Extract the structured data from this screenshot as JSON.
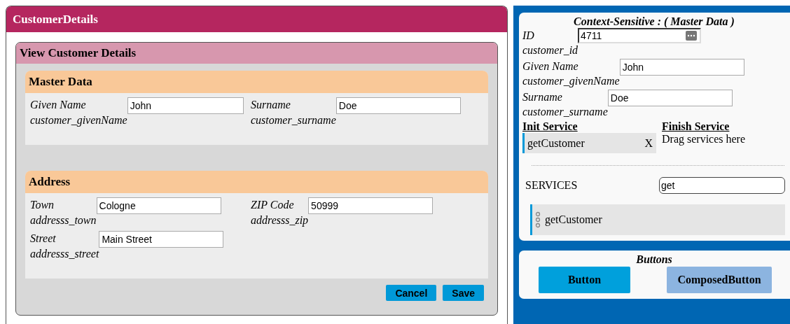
{
  "window": {
    "title": "CustomerDetails"
  },
  "view": {
    "title": "View Customer Details",
    "sections": [
      {
        "title": "Master Data",
        "fields": [
          {
            "label": "Given Name",
            "binding": "customer_givenName",
            "value": "John"
          },
          {
            "label": "Surname",
            "binding": "customer_surname",
            "value": "Doe"
          }
        ]
      },
      {
        "title": "Address",
        "fields": [
          {
            "label": "Town",
            "binding": "addresss_town",
            "value": "Cologne"
          },
          {
            "label": "ZIP Code",
            "binding": "addresss_zip",
            "value": "50999"
          },
          {
            "label": "Street",
            "binding": "addresss_street",
            "value": "Main Street"
          }
        ]
      }
    ],
    "actions": [
      "Cancel",
      "Save"
    ]
  },
  "context": {
    "title": "Context-Sensitive : ( Master Data )",
    "fields": [
      {
        "label": "ID",
        "binding": "customer_id",
        "value": "4711",
        "kind": "lookup"
      },
      {
        "label": "Given Name",
        "binding": "customer_givenName",
        "value": "John",
        "kind": "text"
      },
      {
        "label": "Surname",
        "binding": "customer_surname",
        "value": "Doe",
        "kind": "text"
      }
    ],
    "init_service": {
      "heading": "Init Service",
      "items": [
        {
          "name": "getCustomer",
          "remove": "X"
        }
      ]
    },
    "finish_service": {
      "heading": "Finish Service",
      "hint": "Drag services here"
    },
    "services": {
      "label": "SERVICES",
      "search_value": "get",
      "items": [
        "getCustomer"
      ]
    }
  },
  "buttons_panel": {
    "title": "Buttons",
    "buttons": [
      {
        "label": "Button",
        "kind": "primary"
      },
      {
        "label": "ComposedButton",
        "kind": "composed"
      }
    ]
  }
}
